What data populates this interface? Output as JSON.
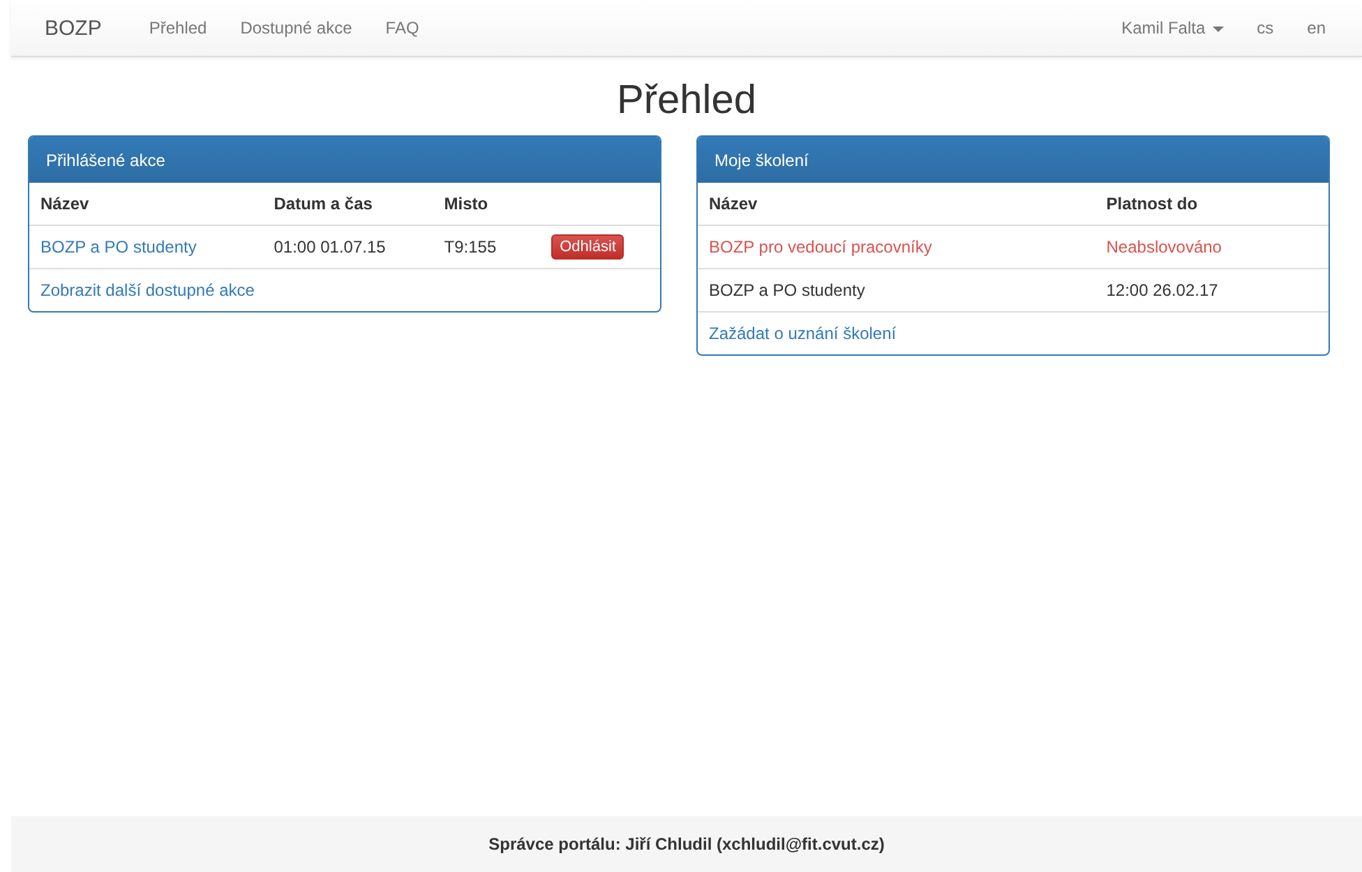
{
  "navbar": {
    "brand": "BOZP",
    "links": [
      {
        "label": "Přehled"
      },
      {
        "label": "Dostupné akce"
      },
      {
        "label": "FAQ"
      }
    ],
    "user": "Kamil Falta",
    "languages": [
      {
        "label": "cs"
      },
      {
        "label": "en"
      }
    ]
  },
  "title": "Přehled",
  "registered_events": {
    "title": "Přihlášené akce",
    "columns": [
      "Název",
      "Datum a čas",
      "Misto"
    ],
    "rows": [
      {
        "name": "BOZP a PO studenty",
        "datetime": "01:00 01.07.15",
        "place": "T9:155",
        "action": "Odhlásit"
      }
    ],
    "more_link": "Zobrazit další dostupné akce"
  },
  "my_trainings": {
    "title": "Moje školení",
    "columns": [
      "Název",
      "Platnost do"
    ],
    "rows": [
      {
        "name": "BOZP pro vedoucí pracovníky",
        "valid_until": "Neabslovováno",
        "missing": true
      },
      {
        "name": "BOZP a PO studenty",
        "valid_until": "12:00 26.02.17",
        "missing": false
      }
    ],
    "request_link": "Zažádat o uznání školení"
  },
  "footer": "Správce portálu: Jiří Chludil (xchludil@fit.cvut.cz)"
}
